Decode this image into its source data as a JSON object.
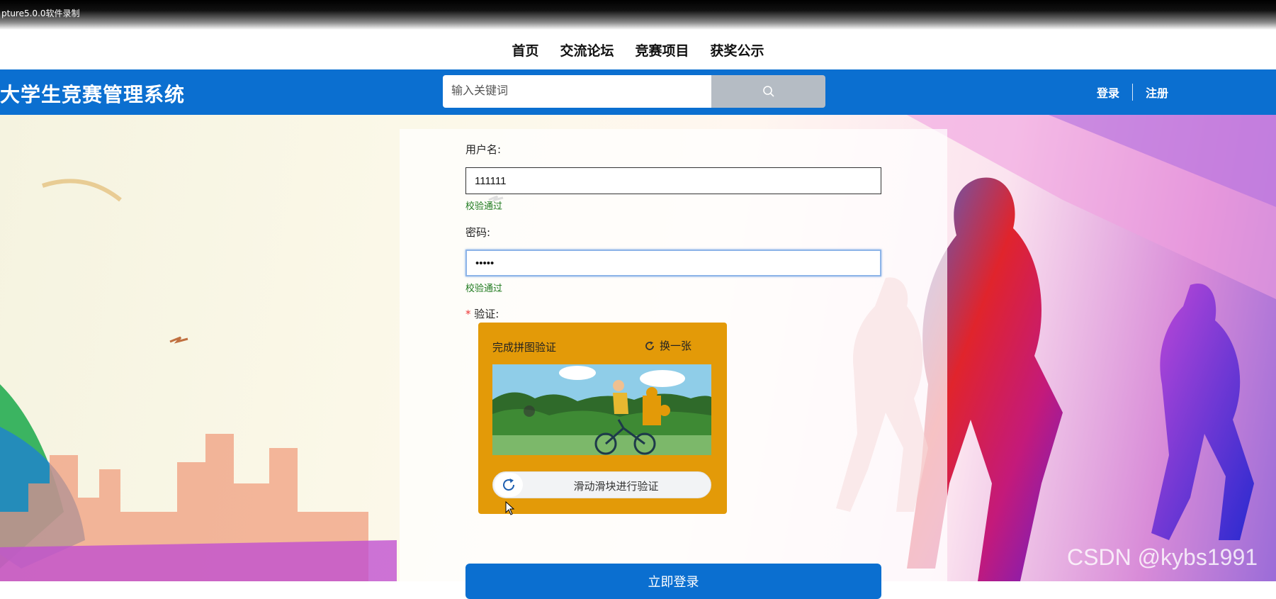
{
  "recorder": {
    "caption": "pture5.0.0软件录制"
  },
  "nav": {
    "items": [
      "首页",
      "交流论坛",
      "竞赛项目",
      "获奖公示"
    ]
  },
  "header": {
    "logo": "大学生竞赛管理系统",
    "search_placeholder": "输入关键词",
    "login": "登录",
    "register": "注册"
  },
  "form": {
    "username_label": "用户名:",
    "username_value": "111111",
    "username_status": "校验通过",
    "password_label": "密码:",
    "password_value": "•••••",
    "password_status": "校验通过",
    "verify_required": "*",
    "verify_label": "验证:",
    "login_button": "立即登录"
  },
  "captcha": {
    "title": "完成拼图验证",
    "refresh": "换一张",
    "slider_text": "滑动滑块进行验证"
  },
  "watermark": "CSDN @kybs1991",
  "colors": {
    "header_blue": "#0b6fd0",
    "captcha_orange": "#e39a08",
    "ok_green": "#1f7a1f"
  }
}
